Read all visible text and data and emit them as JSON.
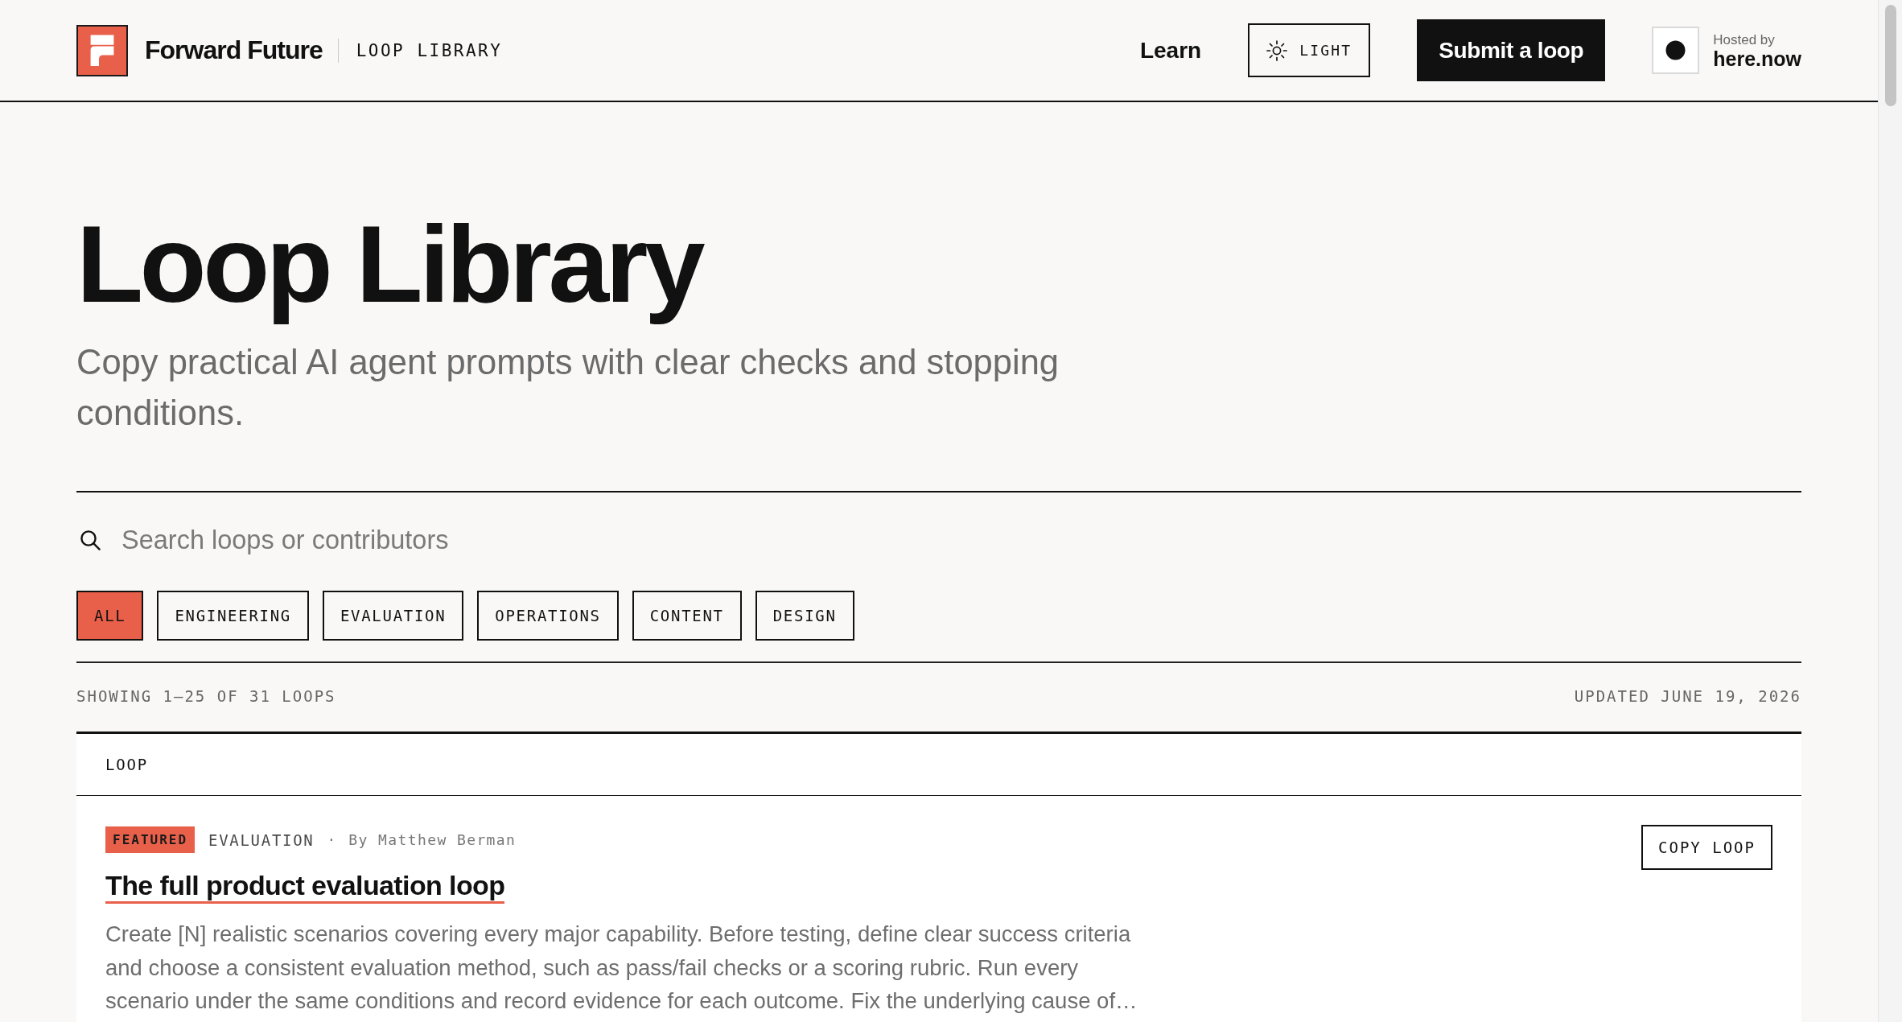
{
  "header": {
    "brand": "Forward Future",
    "section": "LOOP LIBRARY",
    "nav_link": "Learn",
    "theme_button": "LIGHT",
    "submit_button": "Submit a loop",
    "hosted_by": {
      "label": "Hosted by",
      "name": "here.now"
    }
  },
  "hero": {
    "title": "Loop Library",
    "subtitle": "Copy practical AI agent prompts with clear checks and stopping conditions."
  },
  "search": {
    "placeholder": "Search loops or contributors"
  },
  "filters": [
    {
      "label": "ALL",
      "selected": true
    },
    {
      "label": "ENGINEERING",
      "selected": false
    },
    {
      "label": "EVALUATION",
      "selected": false
    },
    {
      "label": "OPERATIONS",
      "selected": false
    },
    {
      "label": "CONTENT",
      "selected": false
    },
    {
      "label": "DESIGN",
      "selected": false
    }
  ],
  "summary": {
    "showing": "SHOWING 1–25 OF 31 LOOPS",
    "updated": "UPDATED JUNE 19, 2026"
  },
  "table": {
    "columns": [
      "LOOP"
    ],
    "rows": [
      {
        "badge": "FEATURED",
        "category": "EVALUATION",
        "separator": "·",
        "author": "By Matthew Berman",
        "title": "The full product evaluation loop",
        "description": "Create [N] realistic scenarios covering every major capability. Before testing, define clear success criteria and choose a consistent evaluation method, such as pass/fail checks or a scoring rubric. Run every scenario under the same conditions and record evidence for each outcome. Fix the underlying cause of…",
        "action": "COPY LOOP"
      }
    ]
  }
}
